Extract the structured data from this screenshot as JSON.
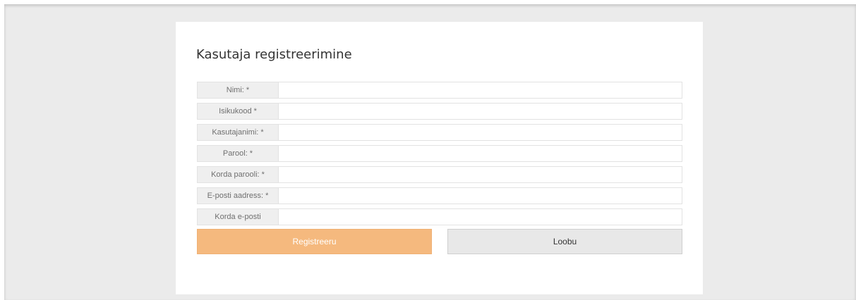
{
  "form": {
    "title": "Kasutaja registreerimine",
    "fields": [
      {
        "label": "Nimi: *",
        "value": "",
        "placeholder": ""
      },
      {
        "label": "Isikukood *",
        "value": "",
        "placeholder": ""
      },
      {
        "label": "Kasutajanimi: *",
        "value": "",
        "placeholder": ""
      },
      {
        "label": "Parool: *",
        "value": "",
        "placeholder": ""
      },
      {
        "label": "Korda parooli: *",
        "value": "",
        "placeholder": ""
      },
      {
        "label": "E-posti aadress: *",
        "value": "",
        "placeholder": ""
      },
      {
        "label": "Korda e-posti",
        "value": "",
        "placeholder": ""
      }
    ],
    "register_label": "Registreeru",
    "cancel_label": "Loobu"
  },
  "colors": {
    "page_background": "#ebebeb",
    "card_background": "#ffffff",
    "primary_button": "#f5b97e",
    "secondary_button": "#e8e8e8",
    "label_background": "#efefef"
  }
}
